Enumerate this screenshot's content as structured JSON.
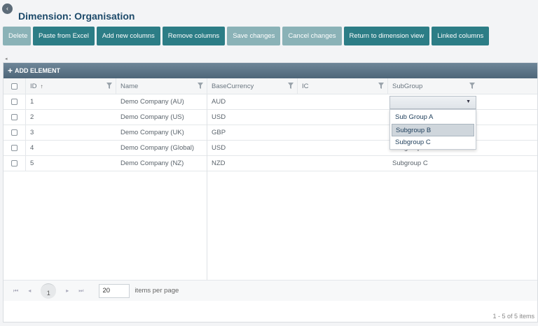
{
  "header": {
    "collapse_icon": "chevron-left-icon",
    "title": "Dimension: Organisation"
  },
  "toolbar": {
    "buttons": [
      {
        "label": "Delete",
        "enabled": false
      },
      {
        "label": "Paste from Excel",
        "enabled": true
      },
      {
        "label": "Add new columns",
        "enabled": true
      },
      {
        "label": "Remove columns",
        "enabled": true
      },
      {
        "label": "Save changes",
        "enabled": false
      },
      {
        "label": "Cancel changes",
        "enabled": false
      },
      {
        "label": "Return to dimension view",
        "enabled": true
      },
      {
        "label": "Linked columns",
        "enabled": true
      }
    ]
  },
  "grid": {
    "add_element_label": "ADD ELEMENT",
    "columns": [
      "ID",
      "Name",
      "BaseCurrency",
      "IC",
      "SubGroup"
    ],
    "sort_indicator": "↑",
    "rows": [
      {
        "id": "1",
        "name": "Demo Company (AU)",
        "currency": "AUD",
        "ic": "",
        "subgroup": ""
      },
      {
        "id": "2",
        "name": "Demo Company (US)",
        "currency": "USD",
        "ic": "",
        "subgroup": ""
      },
      {
        "id": "3",
        "name": "Demo Company (UK)",
        "currency": "GBP",
        "ic": "",
        "subgroup": ""
      },
      {
        "id": "4",
        "name": "Demo Company (Global)",
        "currency": "USD",
        "ic": "",
        "subgroup": "Subgroup C"
      },
      {
        "id": "5",
        "name": "Demo Company (NZ)",
        "currency": "NZD",
        "ic": "",
        "subgroup": "Subgroup C"
      }
    ]
  },
  "dropdown": {
    "options": [
      "Sub Group A",
      "Subgroup B",
      "Subgroup C"
    ],
    "highlighted": "Subgroup B"
  },
  "pager": {
    "current_page": "1",
    "page_size": "20",
    "items_per_page_label": "items per page",
    "summary": "1 - 5 of 5 items"
  },
  "colors": {
    "primary_button": "#2c7d86",
    "disabled_button": "#8ab2b7",
    "title": "#1d4a6a",
    "grid_toolbar": "#56707f"
  }
}
